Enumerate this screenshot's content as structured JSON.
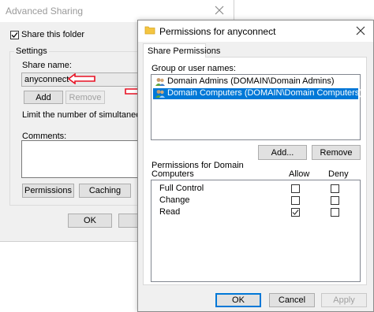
{
  "advanced_sharing": {
    "title": "Advanced Sharing",
    "share_checkbox_label": "Share this folder",
    "share_checked": true,
    "settings_label": "Settings",
    "share_name_label": "Share name:",
    "share_name_value": "anyconnect",
    "add_label": "Add",
    "remove_label": "Remove",
    "limit_label": "Limit the number of simultaneous use",
    "comments_label": "Comments:",
    "permissions_label": "Permissions",
    "caching_label": "Caching",
    "ok_label": "OK",
    "close_icon": "close-icon"
  },
  "permissions_dialog": {
    "title": "Permissions for anyconnect",
    "tab_label": "Share Permissions",
    "group_label": "Group or user names:",
    "users": [
      {
        "name": "Domain Admins (DOMAIN\\Domain Admins)",
        "selected": false,
        "icon": "users-icon"
      },
      {
        "name": "Domain Computers (DOMAIN\\Domain Computers)",
        "selected": true,
        "icon": "users-icon"
      }
    ],
    "add_label": "Add...",
    "remove_label": "Remove",
    "perm_header_line1": "Permissions for Domain",
    "perm_header_line2": "Computers",
    "allow_label": "Allow",
    "deny_label": "Deny",
    "permissions": [
      {
        "name": "Full Control",
        "allow": false,
        "deny": false
      },
      {
        "name": "Change",
        "allow": false,
        "deny": false
      },
      {
        "name": "Read",
        "allow": true,
        "deny": false
      }
    ],
    "ok_label": "OK",
    "cancel_label": "Cancel",
    "apply_label": "Apply",
    "close_icon": "close-icon"
  },
  "colors": {
    "selection": "#0078d7",
    "annotation_arrow": "#e81123"
  }
}
